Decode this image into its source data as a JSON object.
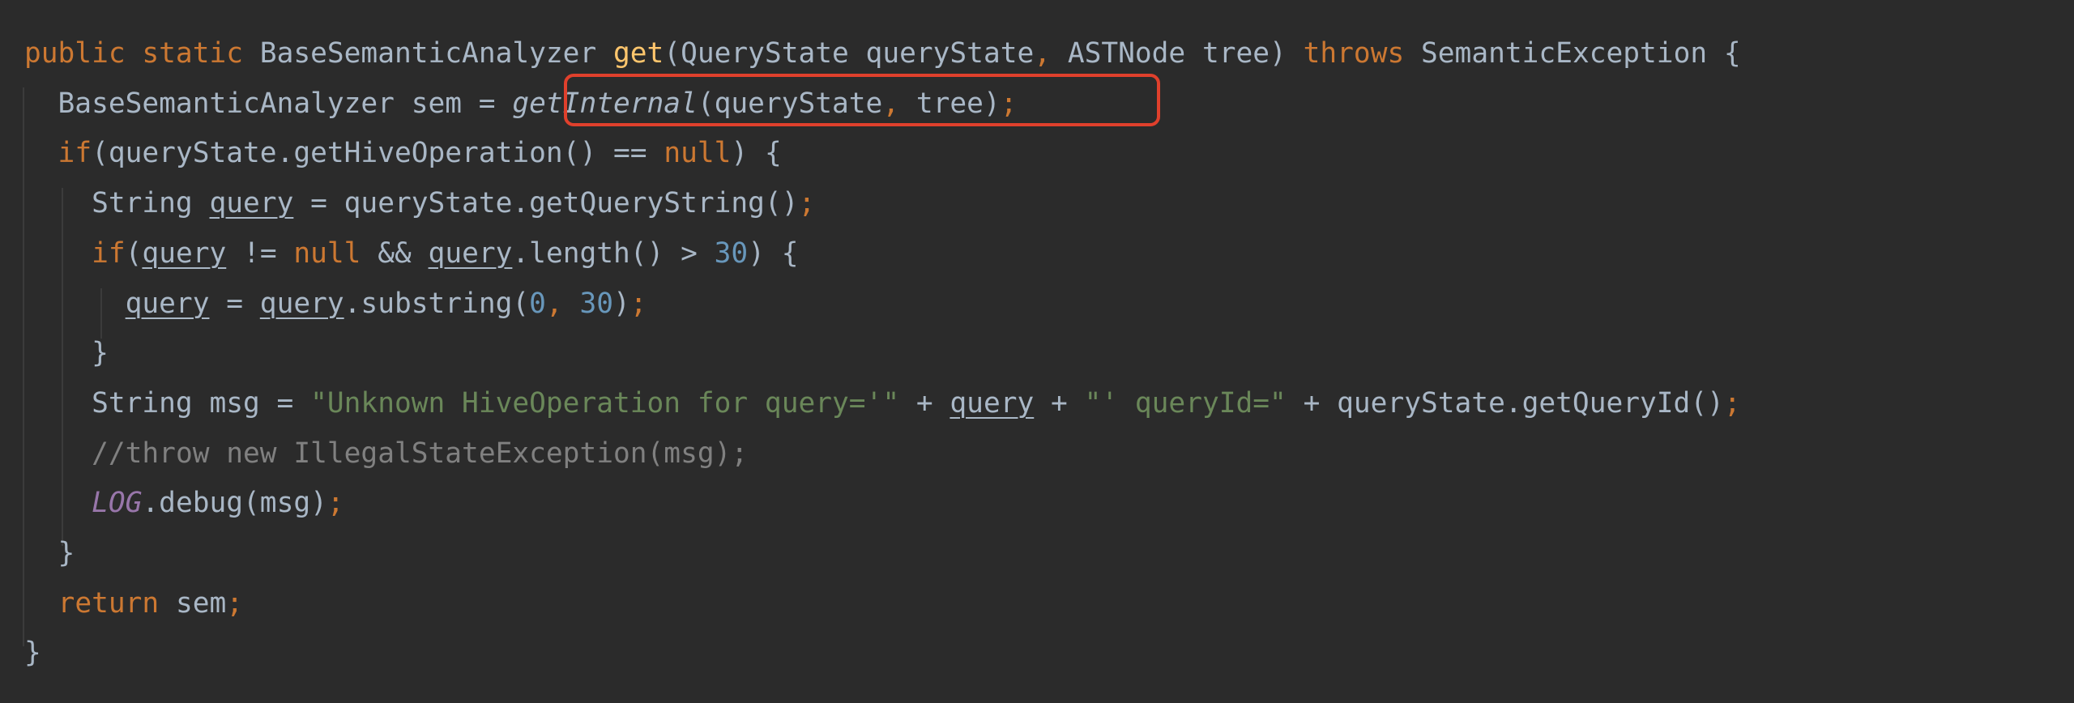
{
  "editor": {
    "lines": [
      {
        "name": "line-method-signature",
        "tokens": [
          {
            "t": "public static ",
            "c": "kw"
          },
          {
            "t": "BaseSemanticAnalyzer ",
            "c": ""
          },
          {
            "t": "get",
            "c": "fn"
          },
          {
            "t": "(QueryState queryState",
            "c": ""
          },
          {
            "t": ", ",
            "c": "kw"
          },
          {
            "t": "ASTNode tree) ",
            "c": ""
          },
          {
            "t": "throws ",
            "c": "kw"
          },
          {
            "t": "SemanticException {",
            "c": ""
          }
        ]
      },
      {
        "name": "line-get-internal-call",
        "tokens": [
          {
            "t": "  BaseSemanticAnalyzer sem = ",
            "c": ""
          },
          {
            "t": "getInternal",
            "c": "static-call"
          },
          {
            "t": "(queryState",
            "c": ""
          },
          {
            "t": ", ",
            "c": "kw"
          },
          {
            "t": "tree)",
            "c": ""
          },
          {
            "t": ";",
            "c": "kw"
          }
        ]
      },
      {
        "name": "line-if-hive-operation",
        "tokens": [
          {
            "t": "  ",
            "c": ""
          },
          {
            "t": "if",
            "c": "kw"
          },
          {
            "t": "(queryState.getHiveOperation() == ",
            "c": ""
          },
          {
            "t": "null",
            "c": "kw"
          },
          {
            "t": ") {",
            "c": ""
          }
        ]
      },
      {
        "name": "line-query-string",
        "tokens": [
          {
            "t": "    String ",
            "c": ""
          },
          {
            "t": "query",
            "c": "var-reassigned"
          },
          {
            "t": " = queryState.getQueryString()",
            "c": ""
          },
          {
            "t": ";",
            "c": "kw"
          }
        ]
      },
      {
        "name": "line-if-query-length",
        "tokens": [
          {
            "t": "    ",
            "c": ""
          },
          {
            "t": "if",
            "c": "kw"
          },
          {
            "t": "(",
            "c": ""
          },
          {
            "t": "query",
            "c": "var-reassigned"
          },
          {
            "t": " != ",
            "c": ""
          },
          {
            "t": "null ",
            "c": "kw"
          },
          {
            "t": "&& ",
            "c": ""
          },
          {
            "t": "query",
            "c": "var-reassigned"
          },
          {
            "t": ".length() > ",
            "c": ""
          },
          {
            "t": "30",
            "c": "num"
          },
          {
            "t": ") {",
            "c": ""
          }
        ]
      },
      {
        "name": "line-substring",
        "tokens": [
          {
            "t": "      ",
            "c": ""
          },
          {
            "t": "query",
            "c": "var-reassigned"
          },
          {
            "t": " = ",
            "c": ""
          },
          {
            "t": "query",
            "c": "var-reassigned"
          },
          {
            "t": ".substring(",
            "c": ""
          },
          {
            "t": "0",
            "c": "num"
          },
          {
            "t": ", ",
            "c": "kw"
          },
          {
            "t": "30",
            "c": "num"
          },
          {
            "t": ")",
            "c": ""
          },
          {
            "t": ";",
            "c": "kw"
          }
        ]
      },
      {
        "name": "line-close-inner-if",
        "tokens": [
          {
            "t": "    }",
            "c": ""
          }
        ]
      },
      {
        "name": "line-msg",
        "tokens": [
          {
            "t": "    String msg = ",
            "c": ""
          },
          {
            "t": "\"Unknown HiveOperation for query='\"",
            "c": "str"
          },
          {
            "t": " + ",
            "c": ""
          },
          {
            "t": "query",
            "c": "var-reassigned"
          },
          {
            "t": " + ",
            "c": ""
          },
          {
            "t": "\"' queryId=\"",
            "c": "str"
          },
          {
            "t": " + queryState.getQueryId()",
            "c": ""
          },
          {
            "t": ";",
            "c": "kw"
          }
        ]
      },
      {
        "name": "line-comment-throw",
        "tokens": [
          {
            "t": "    ",
            "c": ""
          },
          {
            "t": "//throw new IllegalStateException(msg);",
            "c": "cmt"
          }
        ]
      },
      {
        "name": "line-log-debug",
        "tokens": [
          {
            "t": "    ",
            "c": ""
          },
          {
            "t": "LOG",
            "c": "static-field"
          },
          {
            "t": ".debug(msg)",
            "c": ""
          },
          {
            "t": ";",
            "c": "kw"
          }
        ]
      },
      {
        "name": "line-close-outer-if",
        "tokens": [
          {
            "t": "  }",
            "c": ""
          }
        ]
      },
      {
        "name": "line-return",
        "tokens": [
          {
            "t": "  ",
            "c": ""
          },
          {
            "t": "return ",
            "c": "kw"
          },
          {
            "t": "sem",
            "c": ""
          },
          {
            "t": ";",
            "c": "kw"
          }
        ]
      },
      {
        "name": "line-close-method",
        "tokens": [
          {
            "t": "}",
            "c": ""
          }
        ]
      }
    ],
    "colors": {
      "background": "#2b2b2b",
      "default_text": "#a9b7c6",
      "keyword": "#cc7832",
      "method_declaration": "#ffc66d",
      "string": "#6a8759",
      "number": "#6897bb",
      "comment": "#808080",
      "static_field": "#9876aa",
      "highlight_box": "#e0402c"
    }
  }
}
